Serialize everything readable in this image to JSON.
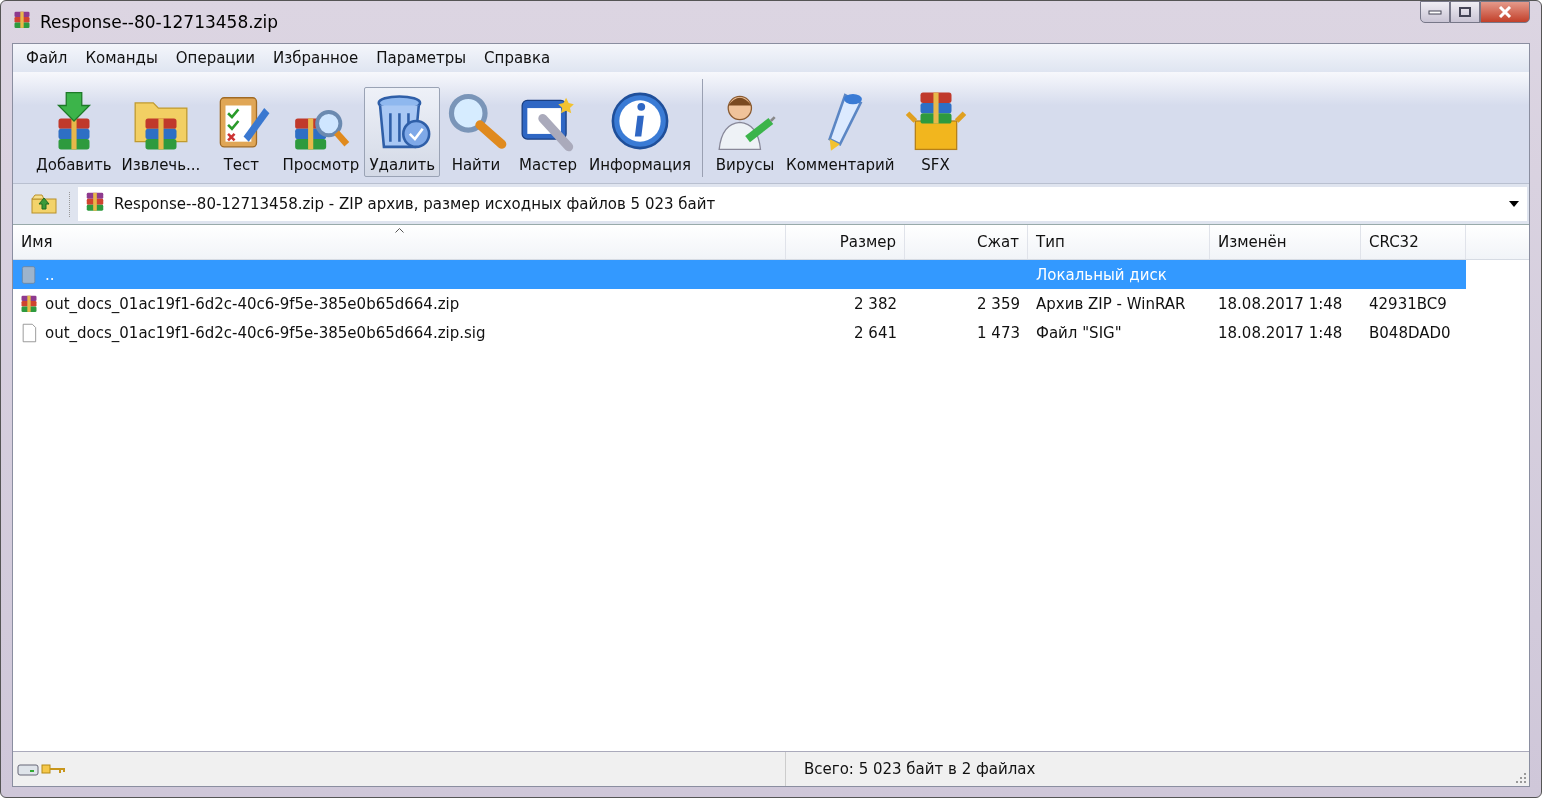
{
  "window": {
    "title": "Response--80-12713458.zip"
  },
  "menu": [
    {
      "label": "Файл"
    },
    {
      "label": "Команды"
    },
    {
      "label": "Операции"
    },
    {
      "label": "Избранное"
    },
    {
      "label": "Параметры"
    },
    {
      "label": "Справка"
    }
  ],
  "toolbar": [
    {
      "buttons": [
        {
          "label": "Добавить",
          "selected": false
        },
        {
          "label": "Извлечь...",
          "selected": false
        },
        {
          "label": "Тест",
          "selected": false
        },
        {
          "label": "Просмотр",
          "selected": false
        },
        {
          "label": "Удалить",
          "selected": true
        },
        {
          "label": "Найти",
          "selected": false
        },
        {
          "label": "Мастер",
          "selected": false
        },
        {
          "label": "Информация",
          "selected": false
        }
      ]
    },
    {
      "buttons": [
        {
          "label": "Вирусы",
          "selected": false
        },
        {
          "label": "Комментарий",
          "selected": false
        },
        {
          "label": "SFX",
          "selected": false
        }
      ]
    }
  ],
  "address": {
    "value": "Response--80-12713458.zip - ZIP архив, размер исходных файлов 5 023 байт"
  },
  "table": {
    "columns": [
      {
        "label": "Имя",
        "sorted": true
      },
      {
        "label": "Размер",
        "sorted": false
      },
      {
        "label": "Сжат",
        "sorted": false
      },
      {
        "label": "Тип",
        "sorted": false
      },
      {
        "label": "Изменён",
        "sorted": false
      },
      {
        "label": "CRC32",
        "sorted": false
      }
    ],
    "rows": [
      {
        "kind": "parent",
        "selected": true,
        "cells": [
          "..",
          "",
          "",
          "Локальный диск",
          "",
          ""
        ]
      },
      {
        "kind": "archive",
        "selected": false,
        "cells": [
          "out_docs_01ac19f1-6d2c-40c6-9f5e-385e0b65d664.zip",
          "2 382",
          "2 359",
          "Архив ZIP - WinRAR",
          "18.08.2017 1:48",
          "42931BC9"
        ]
      },
      {
        "kind": "file",
        "selected": false,
        "cells": [
          "out_docs_01ac19f1-6d2c-40c6-9f5e-385e0b65d664.zip.sig",
          "2 641",
          "1 473",
          "Файл \"SIG\"",
          "18.08.2017 1:48",
          "B048DAD0"
        ]
      }
    ]
  },
  "status_bar": {
    "text": "Всего: 5 023 байт в 2 файлах"
  }
}
